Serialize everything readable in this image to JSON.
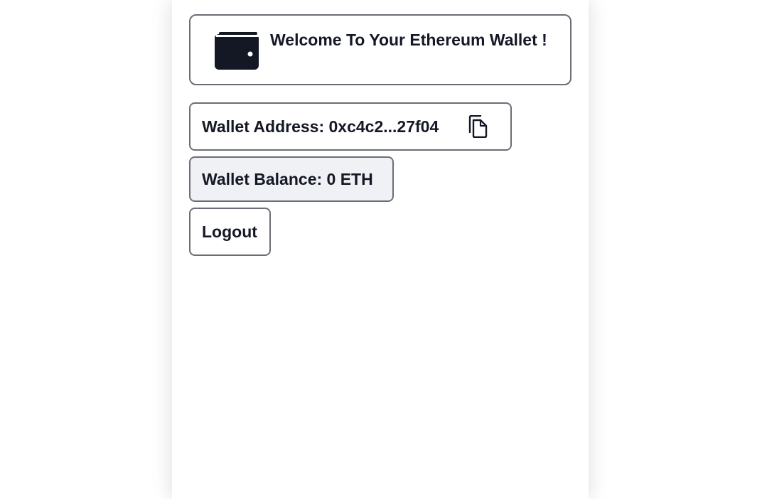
{
  "header": {
    "title": "Welcome To Your Ethereum Wallet !",
    "icon": "wallet-icon"
  },
  "wallet": {
    "address_label": "Wallet Address: 0xc4c2...27f04",
    "copy_icon": "copy-icon",
    "balance_label": "Wallet Balance: 0 ETH"
  },
  "actions": {
    "logout_label": "Logout"
  },
  "colors": {
    "text": "#141824",
    "border": "#6b6e76",
    "balance_bg": "#eff1f5",
    "background": "#ffffff"
  }
}
